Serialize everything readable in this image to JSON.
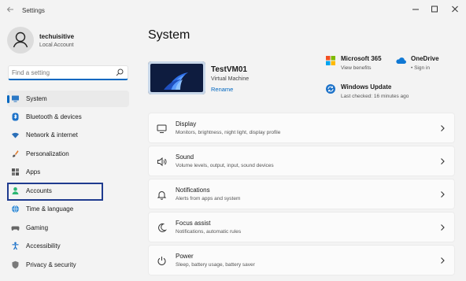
{
  "window": {
    "title": "Settings"
  },
  "profile": {
    "name": "techuisitive",
    "account_type": "Local Account"
  },
  "search": {
    "placeholder": "Find a setting"
  },
  "sidebar": {
    "items": [
      {
        "label": "System",
        "icon": "monitor-icon",
        "selected": true
      },
      {
        "label": "Bluetooth & devices",
        "icon": "bluetooth-icon"
      },
      {
        "label": "Network & internet",
        "icon": "wifi-icon"
      },
      {
        "label": "Personalization",
        "icon": "brush-icon"
      },
      {
        "label": "Apps",
        "icon": "apps-grid-icon"
      },
      {
        "label": "Accounts",
        "icon": "person-icon"
      },
      {
        "label": "Time & language",
        "icon": "globe-clock-icon"
      },
      {
        "label": "Gaming",
        "icon": "gamepad-icon"
      },
      {
        "label": "Accessibility",
        "icon": "accessibility-icon"
      },
      {
        "label": "Privacy & security",
        "icon": "shield-icon"
      }
    ]
  },
  "main": {
    "title": "System",
    "device": {
      "name": "TestVM01",
      "type": "Virtual Machine",
      "rename_label": "Rename"
    },
    "tiles": [
      {
        "title": "Microsoft 365",
        "subtitle": "View benefits",
        "icon": "microsoft-365-icon"
      },
      {
        "title": "OneDrive",
        "subtitle": "• Sign in",
        "icon": "onedrive-cloud-icon"
      },
      {
        "title": "Windows Update",
        "subtitle": "Last checked: 16 minutes ago",
        "icon": "windows-update-icon"
      }
    ],
    "cards": [
      {
        "title": "Display",
        "subtitle": "Monitors, brightness, night light, display profile",
        "icon": "display-icon"
      },
      {
        "title": "Sound",
        "subtitle": "Volume levels, output, input, sound devices",
        "icon": "speaker-icon"
      },
      {
        "title": "Notifications",
        "subtitle": "Alerts from apps and system",
        "icon": "bell-icon"
      },
      {
        "title": "Focus assist",
        "subtitle": "Notifications, automatic rules",
        "icon": "moon-icon"
      },
      {
        "title": "Power",
        "subtitle": "Sleep, battery usage, battery saver",
        "icon": "power-icon"
      }
    ]
  },
  "colors": {
    "accent": "#0067c0",
    "background": "#f3f3f3",
    "card": "#fbfbfb",
    "highlight_border": "#1f3b8f"
  }
}
